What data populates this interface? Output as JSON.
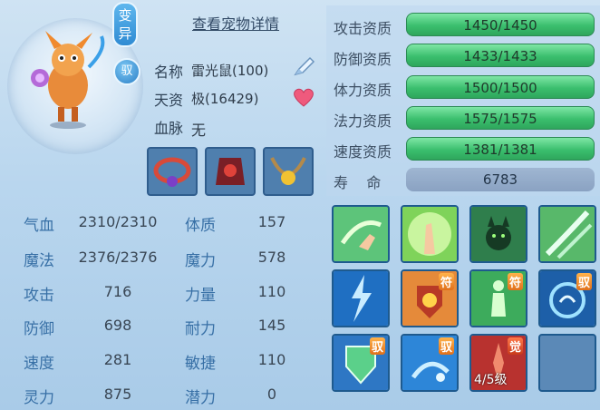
{
  "header": {
    "detail_link": "查看宠物详情"
  },
  "badges": {
    "variant": "变异",
    "yu": "驭"
  },
  "pet": {
    "name_label": "名称",
    "name_value": "雷光鼠(100)",
    "aptitude_label": "天资",
    "aptitude_value": "极(16429)",
    "bloodline_label": "血脉",
    "bloodline_value": "无"
  },
  "stats": [
    {
      "label": "气血",
      "value": "2310/2310"
    },
    {
      "label": "体质",
      "value": "157"
    },
    {
      "label": "魔法",
      "value": "2376/2376"
    },
    {
      "label": "魔力",
      "value": "578"
    },
    {
      "label": "攻击",
      "value": "716"
    },
    {
      "label": "力量",
      "value": "110"
    },
    {
      "label": "防御",
      "value": "698"
    },
    {
      "label": "耐力",
      "value": "145"
    },
    {
      "label": "速度",
      "value": "281"
    },
    {
      "label": "敏捷",
      "value": "110"
    },
    {
      "label": "灵力",
      "value": "875"
    },
    {
      "label": "潜力",
      "value": "0"
    }
  ],
  "qualities": [
    {
      "label": "攻击资质",
      "value": "1450/1450"
    },
    {
      "label": "防御资质",
      "value": "1433/1433"
    },
    {
      "label": "体力资质",
      "value": "1500/1500"
    },
    {
      "label": "法力资质",
      "value": "1575/1575"
    },
    {
      "label": "速度资质",
      "value": "1381/1381"
    }
  ],
  "life": {
    "label": "寿    命",
    "value": "6783"
  },
  "skills": {
    "tags": [
      "符",
      "符",
      "驭",
      "驭",
      "觉"
    ],
    "level_text": "4/5级"
  },
  "colors": {
    "quality_bar": "#3bbf6e",
    "panel_bg": "#b9d6ee",
    "stat_label": "#3870a6"
  }
}
